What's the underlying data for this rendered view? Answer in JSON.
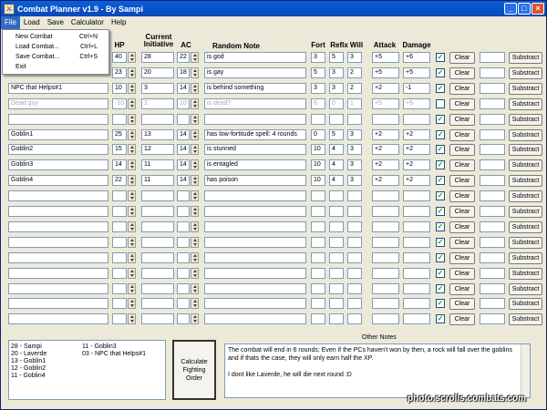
{
  "window": {
    "title": "Combat Planner v1.9 - By Sampi",
    "icon": "app-icon"
  },
  "menu": [
    {
      "label": "File",
      "active": true
    },
    {
      "label": "Load"
    },
    {
      "label": "Save"
    },
    {
      "label": "Calculator"
    },
    {
      "label": "Help"
    }
  ],
  "file_menu": [
    {
      "label": "New Combat",
      "shortcut": "Ctrl+N"
    },
    {
      "label": "Load Combat...",
      "shortcut": "Ctrl+L"
    },
    {
      "label": "Save Combat...",
      "shortcut": "Ctrl+S"
    },
    {
      "label": "Exit",
      "shortcut": ""
    }
  ],
  "headers": {
    "hp": "HP",
    "initiative": "Current Initiative",
    "ac": "AC",
    "note": "Random Note",
    "fort": "Fort",
    "reflex": "Reflx",
    "will": "Will",
    "attack": "Attack",
    "damage": "Damage"
  },
  "rows": [
    {
      "name": "",
      "hp": "40",
      "init": "28",
      "ac": "22",
      "note": "is god",
      "fort": "3",
      "ref": "5",
      "will": "3",
      "atk": "+5",
      "dmg": "+6",
      "checked": true,
      "dim": false
    },
    {
      "name": "",
      "hp": "23",
      "init": "20",
      "ac": "18",
      "note": "is gay",
      "fort": "5",
      "ref": "3",
      "will": "2",
      "atk": "+5",
      "dmg": "+5",
      "checked": true,
      "dim": false
    },
    {
      "name": "NPC that Helps#1",
      "hp": "10",
      "init": "3",
      "ac": "14",
      "note": "is behind something",
      "fort": "3",
      "ref": "3",
      "will": "2",
      "atk": "+2",
      "dmg": "-1",
      "checked": true,
      "dim": false
    },
    {
      "name": "Dead guy",
      "hp": "-10",
      "init": "2",
      "ac": "10",
      "note": "is dead?",
      "fort": "6",
      "ref": "0",
      "will": "1",
      "atk": "+5",
      "dmg": "+6",
      "checked": false,
      "dim": true
    },
    {
      "name": "",
      "hp": "",
      "init": "",
      "ac": "",
      "note": "",
      "fort": "",
      "ref": "",
      "will": "",
      "atk": "",
      "dmg": "",
      "checked": true,
      "dim": false
    },
    {
      "name": "Goblin1",
      "hp": "25",
      "init": "13",
      "ac": "14",
      "note": "has low-fortitude spell: 4 rounds",
      "fort": "0",
      "ref": "5",
      "will": "3",
      "atk": "+2",
      "dmg": "+2",
      "checked": true,
      "dim": false
    },
    {
      "name": "Goblin2",
      "hp": "15",
      "init": "12",
      "ac": "14",
      "note": "is stunned",
      "fort": "10",
      "ref": "4",
      "will": "3",
      "atk": "+2",
      "dmg": "+2",
      "checked": true,
      "dim": false
    },
    {
      "name": "Goblin3",
      "hp": "14",
      "init": "11",
      "ac": "14",
      "note": "is entagled",
      "fort": "10",
      "ref": "4",
      "will": "3",
      "atk": "+2",
      "dmg": "+2",
      "checked": true,
      "dim": false
    },
    {
      "name": "Goblin4",
      "hp": "22",
      "init": "11",
      "ac": "14",
      "note": "has poison",
      "fort": "10",
      "ref": "4",
      "will": "3",
      "atk": "+2",
      "dmg": "+2",
      "checked": true,
      "dim": false
    },
    {
      "name": "",
      "hp": "",
      "init": "",
      "ac": "",
      "note": "",
      "fort": "",
      "ref": "",
      "will": "",
      "atk": "",
      "dmg": "",
      "checked": true,
      "dim": false
    },
    {
      "name": "",
      "hp": "",
      "init": "",
      "ac": "",
      "note": "",
      "fort": "",
      "ref": "",
      "will": "",
      "atk": "",
      "dmg": "",
      "checked": true,
      "dim": false
    },
    {
      "name": "",
      "hp": "",
      "init": "",
      "ac": "",
      "note": "",
      "fort": "",
      "ref": "",
      "will": "",
      "atk": "",
      "dmg": "",
      "checked": true,
      "dim": false
    },
    {
      "name": "",
      "hp": "",
      "init": "",
      "ac": "",
      "note": "",
      "fort": "",
      "ref": "",
      "will": "",
      "atk": "",
      "dmg": "",
      "checked": true,
      "dim": false
    },
    {
      "name": "",
      "hp": "",
      "init": "",
      "ac": "",
      "note": "",
      "fort": "",
      "ref": "",
      "will": "",
      "atk": "",
      "dmg": "",
      "checked": true,
      "dim": false
    },
    {
      "name": "",
      "hp": "",
      "init": "",
      "ac": "",
      "note": "",
      "fort": "",
      "ref": "",
      "will": "",
      "atk": "",
      "dmg": "",
      "checked": true,
      "dim": false
    },
    {
      "name": "",
      "hp": "",
      "init": "",
      "ac": "",
      "note": "",
      "fort": "",
      "ref": "",
      "will": "",
      "atk": "",
      "dmg": "",
      "checked": true,
      "dim": false
    },
    {
      "name": "",
      "hp": "",
      "init": "",
      "ac": "",
      "note": "",
      "fort": "",
      "ref": "",
      "will": "",
      "atk": "",
      "dmg": "",
      "checked": true,
      "dim": false
    },
    {
      "name": "",
      "hp": "",
      "init": "",
      "ac": "",
      "note": "",
      "fort": "",
      "ref": "",
      "will": "",
      "atk": "",
      "dmg": "",
      "checked": true,
      "dim": false
    }
  ],
  "row_buttons": {
    "clear": "Clear",
    "subtract": "Substract"
  },
  "order_left": [
    "28 - Sampi",
    "20 - Laverde",
    "13 - Goblin1",
    "12 - Goblin2",
    "11 - Goblin4"
  ],
  "order_right": [
    "11 - Goblin3",
    "03 - NPC that Helps#1"
  ],
  "calc_button": "Calculate Fighting Order",
  "notes_label": "Other Notes",
  "notes_lines": [
    "The combat will end in 6 rounds: Even if the PCs haven't won by then, a rock will fall over the goblins",
    "and if thats the case, they will only earn half the XP.",
    "",
    "I dont like Laverde, he will die next round :D"
  ],
  "watermark": "photo.scrolls.combats.com"
}
